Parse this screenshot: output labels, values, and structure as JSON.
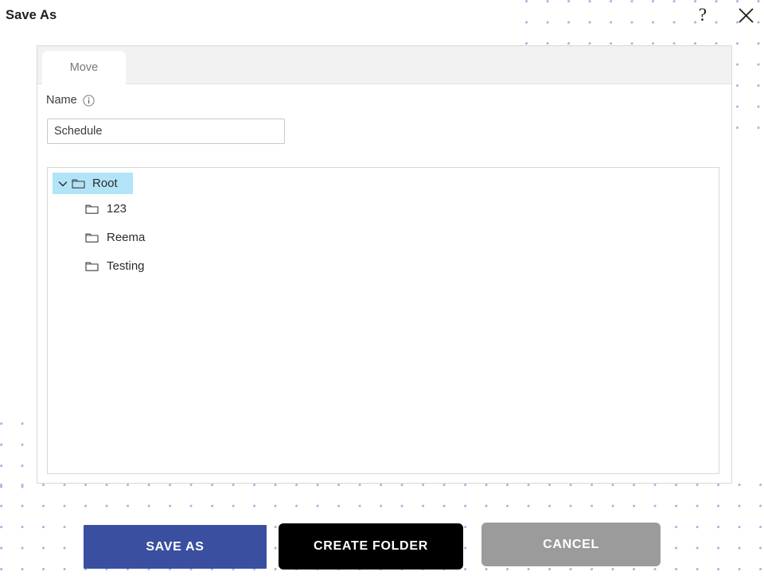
{
  "window": {
    "title": "Save As",
    "help_icon": "question-mark-icon",
    "close_icon": "close-x-icon"
  },
  "tabs": [
    {
      "label": "Move",
      "active": true
    }
  ],
  "form": {
    "name_label": "Name",
    "info_icon": "info-circle-icon",
    "name_value": "Schedule",
    "name_placeholder": "Name"
  },
  "tree": {
    "root": {
      "label": "Root",
      "expanded": true,
      "selected": true,
      "chevron_icon": "chevron-down-icon",
      "folder_icon": "folder-icon",
      "highlight_color": "#b2e4f8"
    },
    "children": [
      {
        "label": "123",
        "folder_icon": "folder-icon"
      },
      {
        "label": "Reema",
        "folder_icon": "folder-icon"
      },
      {
        "label": "Testing",
        "folder_icon": "folder-icon"
      }
    ]
  },
  "footer": {
    "save_as_label": "SAVE AS",
    "create_folder_label": "CREATE FOLDER",
    "cancel_label": "CANCEL",
    "save_as_color": "#3a4fa0",
    "create_folder_color": "#000000",
    "cancel_color": "#9b9b9b"
  },
  "background": {
    "dot_color": "#aab4e8"
  }
}
